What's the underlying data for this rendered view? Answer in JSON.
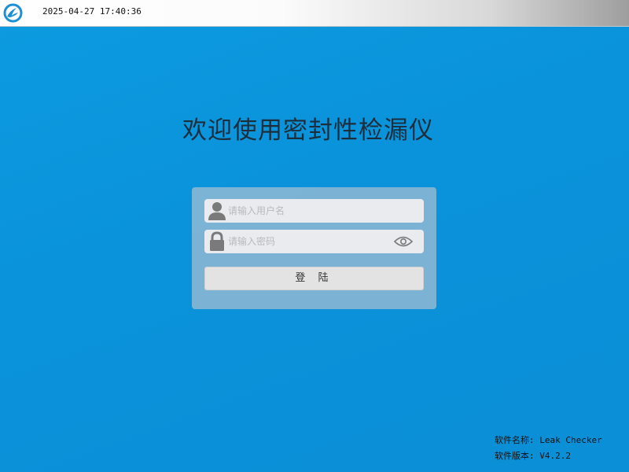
{
  "statusbar": {
    "logo_icon": "app-logo-icon",
    "datetime": "2025-04-27 17:40:36"
  },
  "title": "欢迎使用密封性检漏仪",
  "login": {
    "username_placeholder": "请输入用户名",
    "username_value": "",
    "password_placeholder": "请输入密码",
    "password_value": "",
    "username_icon": "user-icon",
    "password_icon": "lock-icon",
    "show_password_icon": "eye-icon",
    "login_label": "登 陆"
  },
  "footer": {
    "software_name_label": "软件名称:",
    "software_name": "Leak Checker",
    "software_version_label": "软件版本:",
    "software_version": "V4.2.2"
  },
  "colors": {
    "background": "#0a95dc",
    "topbar_start": "#ffffff",
    "topbar_end": "#9e9e9e",
    "panel": "#aab6c8",
    "input_bg": "#e9ebef",
    "button_bg": "#e3e3e3",
    "title_text": "#1c2e3b"
  }
}
